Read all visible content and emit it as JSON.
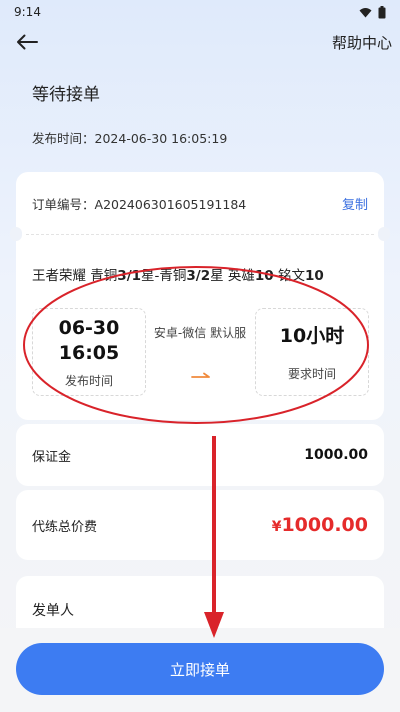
{
  "status_bar": {
    "time": "9:14"
  },
  "nav": {
    "help_label": "帮助中心"
  },
  "order_status": "等待接单",
  "publish": {
    "label": "发布时间：",
    "datetime": "2024-06-30 16:05:19"
  },
  "order": {
    "number_label": "订单编号：",
    "number": "A202406301605191184",
    "copy_label": "复制",
    "title_parts": [
      {
        "t": "王者荣耀 青铜",
        "b": false
      },
      {
        "t": "3/1",
        "b": true
      },
      {
        "t": "星-青铜",
        "b": false
      },
      {
        "t": "3/2",
        "b": true
      },
      {
        "t": "星 英雄",
        "b": false
      },
      {
        "t": "10",
        "b": true
      },
      {
        "t": " 铭文",
        "b": false
      },
      {
        "t": "10",
        "b": true
      }
    ],
    "publish_date": "06-30",
    "publish_time": "16:05",
    "publish_time_label": "发布时间",
    "platform_text": "安卓-微信 默认服",
    "required_hours": "10小时",
    "required_label": "要求时间"
  },
  "deposit": {
    "label": "保证金",
    "value": "1000.00"
  },
  "total": {
    "label": "代练总价费",
    "currency": "¥",
    "value": "1000.00"
  },
  "sender": {
    "label": "发单人"
  },
  "actions": {
    "accept_label": "立即接单"
  },
  "colors": {
    "accent": "#3d7cf2",
    "price": "#e52b2b",
    "annotation": "#d9232a"
  }
}
